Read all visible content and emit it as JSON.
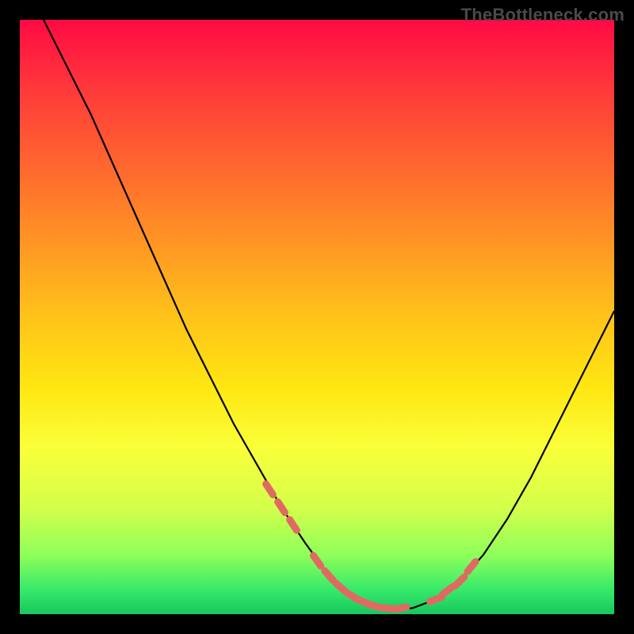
{
  "watermark": "TheBottleneck.com",
  "colors": {
    "gradient_top": "#ff0a44",
    "gradient_bottom": "#18c75e",
    "curve": "#000000",
    "markers": "#e06a62",
    "frame_bg": "#000000"
  },
  "chart_data": {
    "type": "line",
    "title": "",
    "xlabel": "",
    "ylabel": "",
    "xlim": [
      0,
      100
    ],
    "ylim": [
      0,
      100
    ],
    "series": [
      {
        "name": "bottleneck-curve",
        "x": [
          4,
          8,
          12,
          16,
          20,
          24,
          28,
          32,
          36,
          40,
          44,
          48,
          52,
          54,
          56,
          58,
          60,
          62,
          66,
          70,
          74,
          78,
          82,
          86,
          90,
          94,
          98,
          100
        ],
        "y": [
          100,
          92,
          84,
          75,
          66,
          57,
          48,
          40,
          32,
          25,
          18,
          12,
          6.5,
          4.5,
          3,
          2,
          1.3,
          1,
          1,
          2.5,
          5.5,
          10,
          16,
          23,
          31,
          39,
          47,
          51
        ]
      }
    ],
    "markers": {
      "name": "highlight-dots",
      "x": [
        42,
        44,
        46,
        50,
        52,
        54,
        56,
        58,
        60,
        62,
        64,
        70,
        72,
        74,
        76
      ],
      "y": [
        21,
        18,
        15,
        9,
        6.5,
        4.5,
        3,
        2,
        1.3,
        1,
        1,
        2.5,
        4,
        5.5,
        8
      ]
    }
  }
}
